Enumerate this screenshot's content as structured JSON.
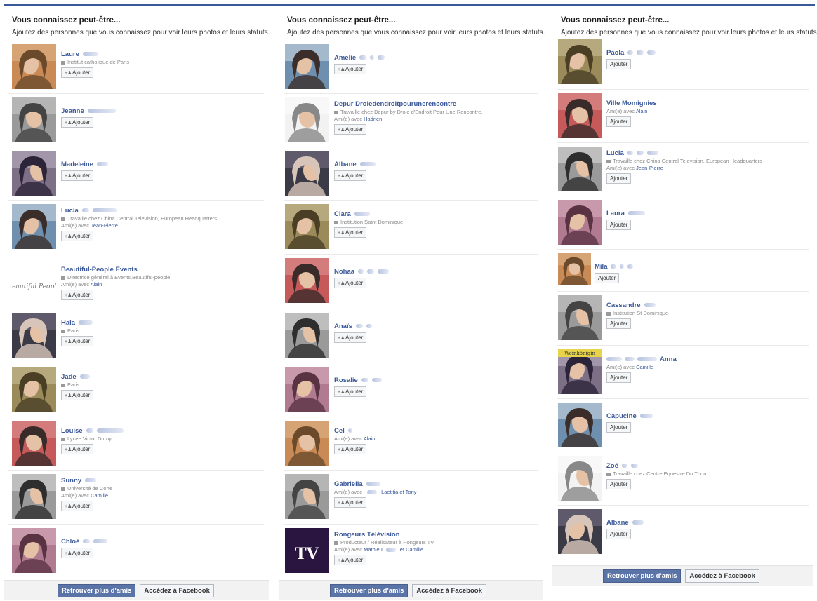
{
  "panels": [
    {
      "title": "Vous connaissez peut-être...",
      "subtitle": "Ajoutez des personnes que vous connaissez pour voir leurs photos et leurs statuts.",
      "primary_button": "Retrouver plus d'amis",
      "secondary_button": "Accédez à Facebook",
      "people": [
        {
          "name": "Laure",
          "info": "Institut catholique de Paris",
          "friend": "",
          "add": "Ajouter"
        },
        {
          "name": "Jeanne",
          "info": "",
          "friend": "",
          "add": "Ajouter"
        },
        {
          "name": "Madeleine",
          "info": "",
          "friend": "",
          "add": "Ajouter"
        },
        {
          "name": "Lucia",
          "info": "Travaille chez China Central Television, European Headquarters",
          "friend": "Jean-Pierre",
          "add": "Ajouter"
        },
        {
          "name": "Beautiful-People Events",
          "info": "Directrice général à Events.Beautiful-people",
          "friend": "Alain",
          "add": "Ajouter",
          "logo": "Beautiful People"
        },
        {
          "name": "Hala",
          "info": "Paris",
          "friend": "",
          "add": "Ajouter"
        },
        {
          "name": "Jade",
          "info": "Paris",
          "friend": "",
          "add": "Ajouter"
        },
        {
          "name": "Louise",
          "info": "Lycée Victor Duruy",
          "friend": "",
          "add": "Ajouter"
        },
        {
          "name": "Sunny",
          "info": "Université de Corte",
          "friend": "Camille",
          "add": "Ajouter"
        },
        {
          "name": "Chloé",
          "info": "",
          "friend": "",
          "add": "Ajouter"
        }
      ]
    },
    {
      "title": "Vous connaissez peut-être...",
      "subtitle": "Ajoutez des personnes que vous connaissez pour voir leurs photos et leurs statuts.",
      "primary_button": "Retrouver plus d'amis",
      "secondary_button": "Accédez à Facebook",
      "people": [
        {
          "name": "Amelie",
          "info": "",
          "friend": "",
          "add": "Ajouter"
        },
        {
          "name": "Depur Droledendroitpourunerencontre",
          "info": "Travaille chez Depur by Drole d'Endroit Pour Une Rencontre.",
          "friend": "Hadrien",
          "add": "Ajouter"
        },
        {
          "name": "Albane",
          "info": "",
          "friend": "",
          "add": "Ajouter"
        },
        {
          "name": "Clara",
          "info": "Institution Saint Dominique",
          "friend": "",
          "add": "Ajouter"
        },
        {
          "name": "Nohaa",
          "info": "",
          "friend": "",
          "add": "Ajouter"
        },
        {
          "name": "Anaïs",
          "info": "",
          "friend": "",
          "add": "Ajouter"
        },
        {
          "name": "Rosalie",
          "info": "",
          "friend": "",
          "add": "Ajouter"
        },
        {
          "name": "Cel",
          "info": "",
          "friend": "Alain",
          "add": "Ajouter"
        },
        {
          "name": "Gabriella",
          "info": "",
          "friend": "",
          "friend_extra": "Laetitia et Tony",
          "add": "Ajouter"
        },
        {
          "name": "Rongeurs Télévision",
          "info": "Producteur / Réalisateur à Rongeurs TV",
          "friend": "Mathieu",
          "friend_extra": "et Camille",
          "add": "Ajouter",
          "logo": "TV"
        }
      ]
    },
    {
      "title": "Vous connaissez peut-être...",
      "subtitle": "Ajoutez des personnes que vous connaissez pour voir leurs photos et leurs statuts.",
      "primary_button": "Retrouver plus d'amis",
      "secondary_button": "Accédez à Facebook",
      "people": [
        {
          "name": "Paola",
          "info": "",
          "friend": "",
          "add": "Ajouter"
        },
        {
          "name": "Ville Momignies",
          "info": "",
          "friend": "Alain",
          "add": "Ajouter"
        },
        {
          "name": "Lucia",
          "info": "Travaille chez China Central Television, European Headquarters",
          "friend": "Jean-Pierre",
          "add": "Ajouter"
        },
        {
          "name": "Laura",
          "info": "",
          "friend": "",
          "add": "Ajouter"
        },
        {
          "name": "Mila",
          "info": "",
          "friend": "",
          "add": "Ajouter"
        },
        {
          "name": "Cassandre",
          "info": "Institution St Dominique",
          "friend": "",
          "add": "Ajouter"
        },
        {
          "name": "Anna",
          "info": "",
          "friend": "Camille",
          "add": "Ajouter",
          "logo": "Weinkönigin"
        },
        {
          "name": "Capucine",
          "info": "",
          "friend": "",
          "add": "Ajouter"
        },
        {
          "name": "Zoé",
          "info": "Travaille chez Centre Equestre Du Thou",
          "friend": "",
          "add": "Ajouter"
        },
        {
          "name": "Albane",
          "info": "",
          "friend": "",
          "add": "Ajouter"
        }
      ]
    }
  ],
  "labels": {
    "friend_prefix": "Ami(e) avec"
  },
  "colors": {
    "brand": "#3b5998",
    "primary_button": "#5b74a8",
    "link": "#3b5998"
  }
}
